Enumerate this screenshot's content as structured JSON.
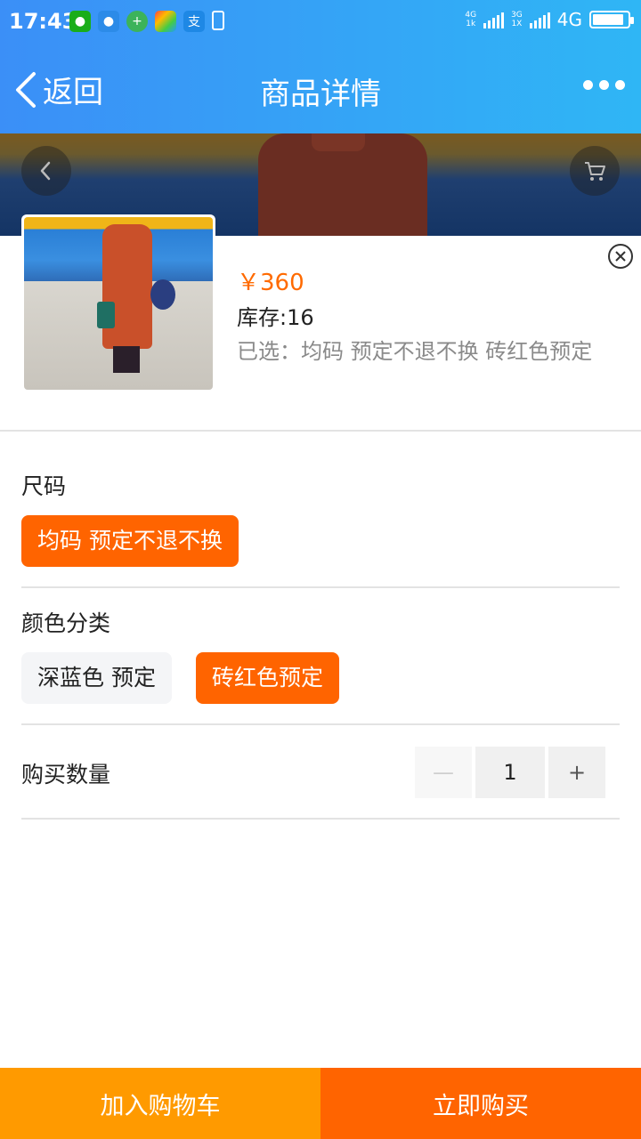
{
  "status_bar": {
    "time": "17:43",
    "network_top": "4G",
    "network_bottom": "1k",
    "network2_top": "3G",
    "network2_bottom": "1X",
    "network_label": "4G",
    "battery_level": 0.9,
    "apps": [
      "wechat-icon",
      "chat-icon",
      "plus-app-icon",
      "browser-icon",
      "alipay-icon",
      "charging-icon"
    ],
    "alipay_glyph": "支"
  },
  "nav": {
    "back_label": "返回",
    "title": "商品详情"
  },
  "product": {
    "price": "￥360",
    "stock": "库存:16",
    "selected": "已选：均码 预定不退不换 砖红色预定"
  },
  "size": {
    "label": "尺码",
    "options": [
      {
        "label": "均码 预定不退不换",
        "selected": true
      }
    ]
  },
  "color": {
    "label": "颜色分类",
    "options": [
      {
        "label": "深蓝色 预定",
        "selected": false
      },
      {
        "label": "砖红色预定",
        "selected": true
      }
    ]
  },
  "quantity": {
    "label": "购买数量",
    "minus": "—",
    "value": "1",
    "plus": "+"
  },
  "actions": {
    "add_to_cart": "加入购物车",
    "buy_now": "立即购买"
  },
  "colors": {
    "accent": "#ff6400",
    "cart_button": "#ff9a00",
    "header_start": "#3b8ff7",
    "header_end": "#2fb6f5"
  }
}
